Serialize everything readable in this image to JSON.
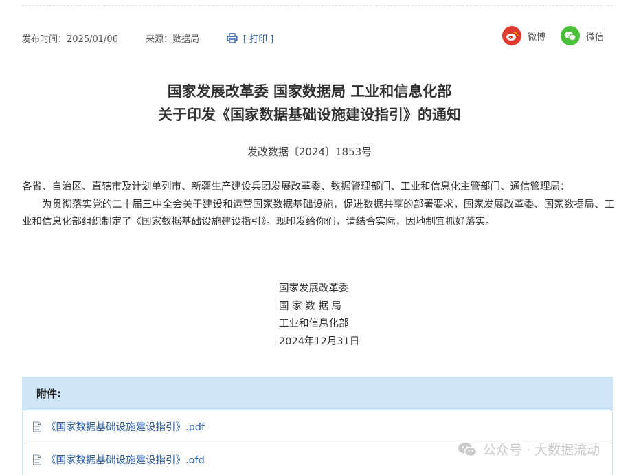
{
  "meta": {
    "publish_time": "发布时间：2025/01/06",
    "source": "来源：数据局",
    "print_label": "[ 打印 ]"
  },
  "share": {
    "weibo_label": "微博",
    "wechat_label": "微信"
  },
  "document": {
    "title_line1": "国家发展改革委 国家数据局 工业和信息化部",
    "title_line2": "关于印发《国家数据基础设施建设指引》的通知",
    "doc_number": "发改数据〔2024〕1853号",
    "salutation": "各省、自治区、直辖市及计划单列市、新疆生产建设兵团发展改革委、数据管理部门、工业和信息化主管部门、通信管理局：",
    "paragraph": "为贯彻落实党的二十届三中全会关于建设和运营国家数据基础设施，促进数据共享的部署要求，国家发展改革委、国家数据局、工业和信息化部组织制定了《国家数据基础设施建设指引》。现印发给你们，请结合实际，因地制宜抓好落实。",
    "signatures": [
      "国家发展改革委",
      "国 家 数 据 局",
      "工业和信息化部"
    ],
    "date": "2024年12月31日"
  },
  "attachments": {
    "heading": "附件:",
    "files": [
      "《国家数据基础设施建设指引》.pdf",
      "《国家数据基础设施建设指引》.ofd"
    ]
  },
  "watermark": {
    "text": "公众号 · 大数据流动"
  },
  "colors": {
    "link": "#2a5caa",
    "weibo": "#e03a2f",
    "wechat": "#4cbf3a",
    "attachment_header": "#cfe6f8"
  },
  "icons": [
    "printer-icon",
    "weibo-icon",
    "wechat-icon",
    "document-icon",
    "wechat-watermark-icon"
  ]
}
